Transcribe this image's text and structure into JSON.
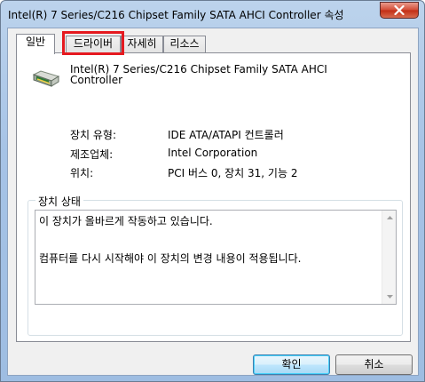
{
  "window": {
    "title": "Intel(R) 7 Series/C216 Chipset Family SATA AHCI Controller 속성"
  },
  "tabs": [
    {
      "label": "일반",
      "active": true
    },
    {
      "label": "드라이버",
      "active": false
    },
    {
      "label": "자세히",
      "active": false
    },
    {
      "label": "리소스",
      "active": false
    }
  ],
  "device": {
    "name": "Intel(R) 7 Series/C216 Chipset Family SATA AHCI Controller",
    "icon": "storage-controller-icon"
  },
  "properties": [
    {
      "label": "장치 유형:",
      "value": "IDE ATA/ATAPI 컨트롤러"
    },
    {
      "label": "제조업체:",
      "value": "Intel Corporation"
    },
    {
      "label": "위치:",
      "value": "PCI 버스 0, 장치 31, 기능 2"
    }
  ],
  "status": {
    "legend": "장치 상태",
    "text": "이 장치가 올바르게 작동하고 있습니다.\n\n컴퓨터를 다시 시작해야 이 장치의 변경 내용이 적용됩니다."
  },
  "buttons": {
    "ok": "확인",
    "cancel": "취소"
  },
  "colors": {
    "highlight": "#e5191f",
    "close": "#c22d14"
  }
}
